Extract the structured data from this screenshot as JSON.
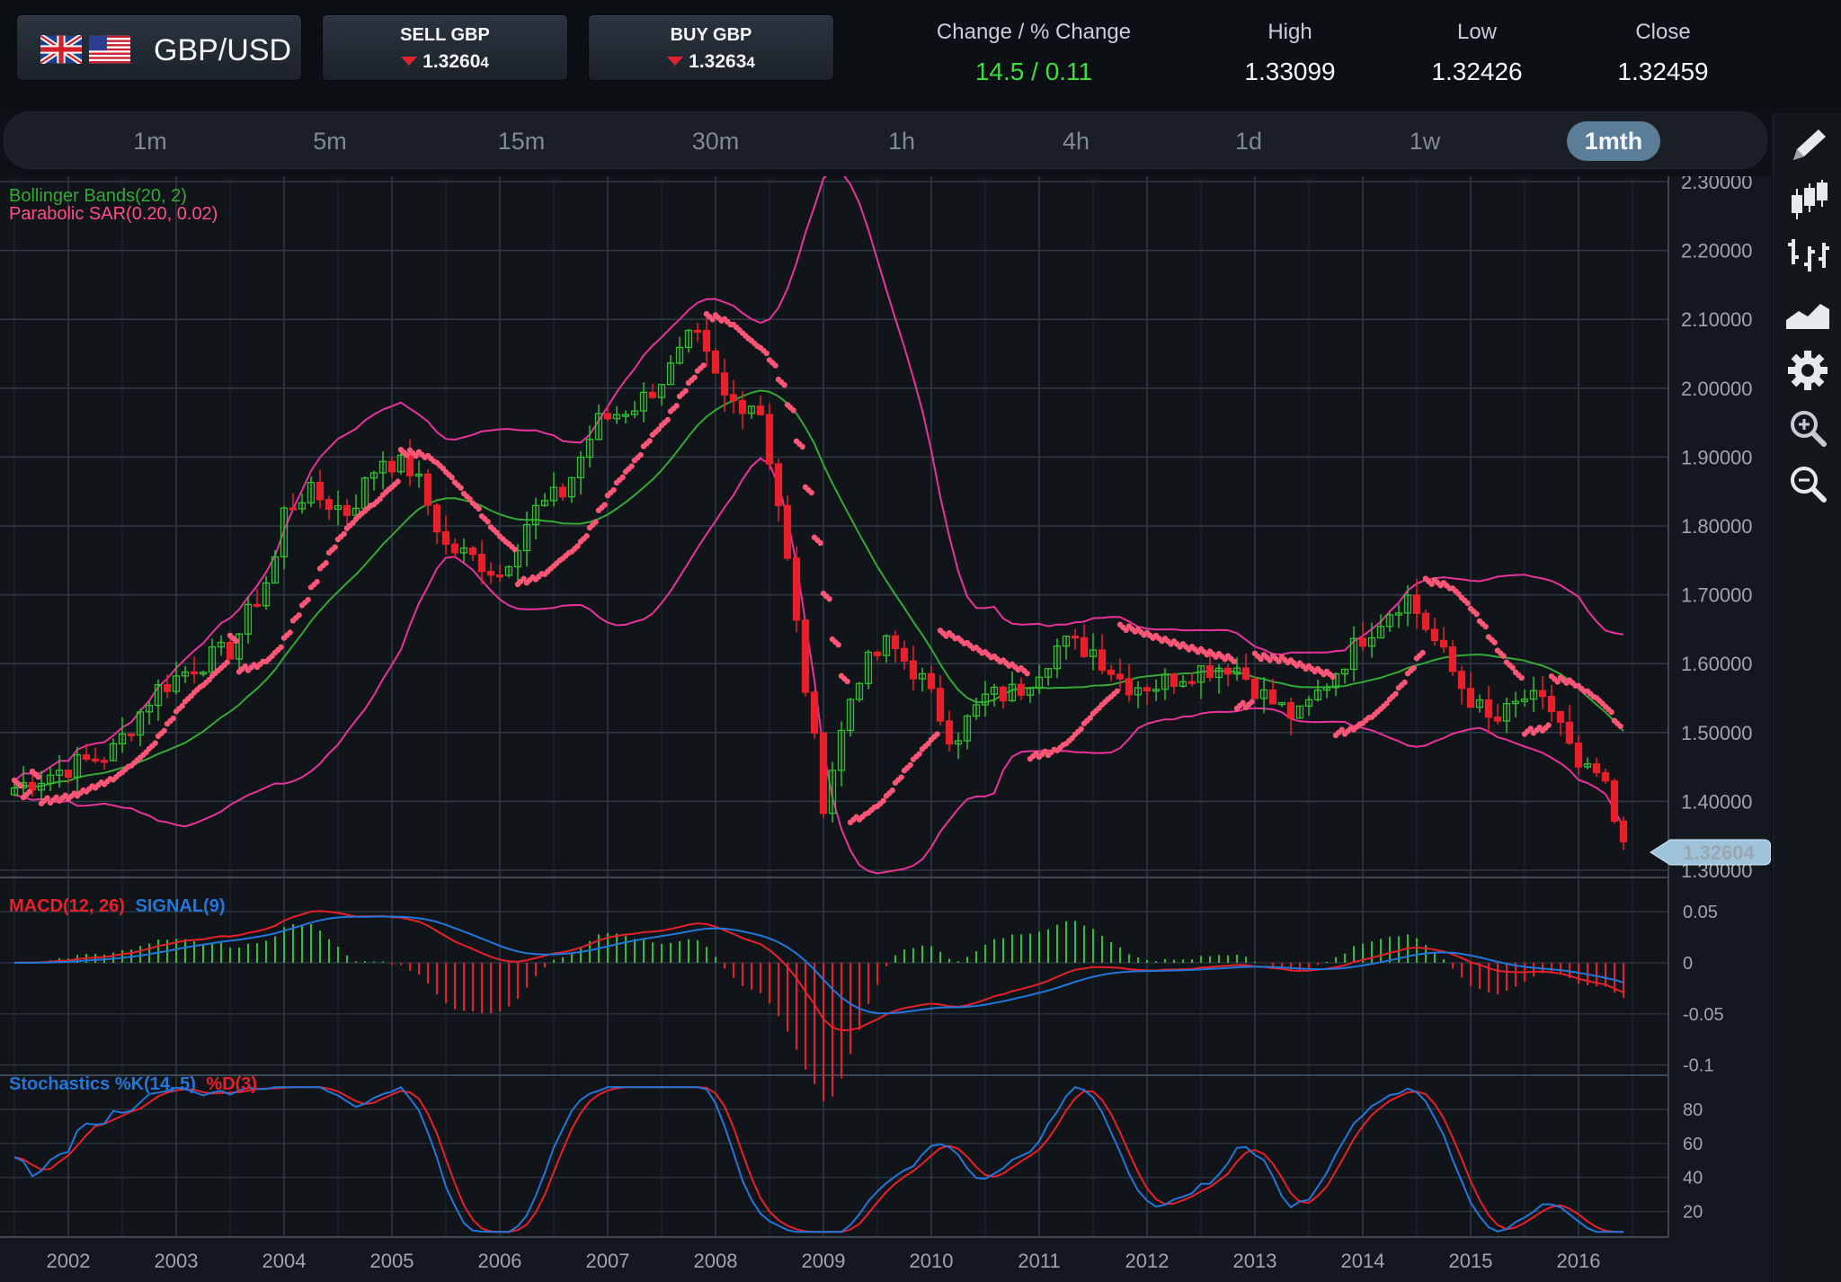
{
  "header": {
    "pair": "GBP/USD",
    "sell": {
      "label": "SELL GBP",
      "price_main": "1.3260",
      "price_pip": "4"
    },
    "buy": {
      "label": "BUY GBP",
      "price_main": "1.3263",
      "price_pip": "4"
    },
    "stats": [
      {
        "label": "Change / % Change",
        "value": "14.5 / 0.11"
      },
      {
        "label": "High",
        "value": "1.33099"
      },
      {
        "label": "Low",
        "value": "1.32426"
      },
      {
        "label": "Close",
        "value": "1.32459"
      }
    ]
  },
  "timeframes": [
    "1m",
    "5m",
    "15m",
    "30m",
    "1h",
    "4h",
    "1d",
    "1w",
    "1mth"
  ],
  "active_timeframe": "1mth",
  "tools": [
    "pencil-icon",
    "candlestick-icon",
    "ohlc-bars-icon",
    "area-chart-icon",
    "gear-icon",
    "zoom-in-icon",
    "zoom-out-icon"
  ],
  "colors": {
    "bull": "#2fbf2f",
    "bear": "#e8202c",
    "bollinger_outer": "#e8339c",
    "bollinger_mid": "#35a835",
    "sar": "#ff5577",
    "macd": "#e8202c",
    "signal": "#2277dd",
    "grid": "#2e3a47"
  },
  "chart_data": [
    {
      "type": "candlestick",
      "indicators": [
        "Bollinger Bands(20, 2)",
        "Parabolic SAR(0.20, 0.02)"
      ],
      "x_labels": [
        "2002",
        "2003",
        "2004",
        "2005",
        "2006",
        "2007",
        "2008",
        "2009",
        "2010",
        "2011",
        "2012",
        "2013",
        "2014",
        "2015",
        "2016"
      ],
      "y_ticks": [
        "2.30000",
        "2.20000",
        "2.10000",
        "2.00000",
        "1.90000",
        "1.80000",
        "1.70000",
        "1.60000",
        "1.50000",
        "1.40000",
        "1.30000"
      ],
      "ylim": [
        1.3,
        2.3
      ],
      "current_price_label": "1.32604",
      "current_price": 1.32604,
      "price_path_start_year": 2001.5,
      "price_path": [
        [
          2001.5,
          1.42
        ],
        [
          2002.0,
          1.45
        ],
        [
          2002.4,
          1.47
        ],
        [
          2002.8,
          1.56
        ],
        [
          2003.2,
          1.6
        ],
        [
          2003.5,
          1.62
        ],
        [
          2003.9,
          1.74
        ],
        [
          2004.0,
          1.82
        ],
        [
          2004.2,
          1.85
        ],
        [
          2004.6,
          1.82
        ],
        [
          2004.9,
          1.9
        ],
        [
          2005.2,
          1.88
        ],
        [
          2005.5,
          1.77
        ],
        [
          2005.8,
          1.75
        ],
        [
          2006.0,
          1.73
        ],
        [
          2006.3,
          1.82
        ],
        [
          2006.6,
          1.85
        ],
        [
          2006.9,
          1.95
        ],
        [
          2007.3,
          1.98
        ],
        [
          2007.6,
          2.03
        ],
        [
          2007.8,
          2.08
        ],
        [
          2008.1,
          1.98
        ],
        [
          2008.4,
          1.98
        ],
        [
          2008.6,
          1.82
        ],
        [
          2008.8,
          1.6
        ],
        [
          2009.0,
          1.4
        ],
        [
          2009.3,
          1.58
        ],
        [
          2009.6,
          1.63
        ],
        [
          2009.9,
          1.58
        ],
        [
          2010.2,
          1.49
        ],
        [
          2010.5,
          1.55
        ],
        [
          2010.8,
          1.56
        ],
        [
          2011.2,
          1.63
        ],
        [
          2011.5,
          1.62
        ],
        [
          2011.8,
          1.57
        ],
        [
          2012.1,
          1.57
        ],
        [
          2012.4,
          1.59
        ],
        [
          2012.8,
          1.6
        ],
        [
          2013.1,
          1.55
        ],
        [
          2013.4,
          1.52
        ],
        [
          2013.7,
          1.58
        ],
        [
          2014.0,
          1.64
        ],
        [
          2014.4,
          1.7
        ],
        [
          2014.6,
          1.65
        ],
        [
          2014.9,
          1.57
        ],
        [
          2015.2,
          1.51
        ],
        [
          2015.5,
          1.55
        ],
        [
          2015.8,
          1.53
        ],
        [
          2016.0,
          1.44
        ],
        [
          2016.2,
          1.44
        ],
        [
          2016.4,
          1.33
        ]
      ]
    },
    {
      "type": "line",
      "title": "MACD(12, 26) SIGNAL(9)",
      "series": [
        {
          "name": "MACD(12, 26)"
        },
        {
          "name": "SIGNAL(9)"
        }
      ],
      "y_ticks": [
        "0.05",
        "0",
        "-0.05",
        "-0.1"
      ],
      "ylim": [
        -0.11,
        0.08
      ]
    },
    {
      "type": "line",
      "title": "Stochastics %K(14, 5) %D(3)",
      "series": [
        {
          "name": "%K(14, 5)"
        },
        {
          "name": "%D(3)"
        }
      ],
      "y_ticks": [
        "80",
        "60",
        "40",
        "20"
      ],
      "ylim": [
        5,
        100
      ]
    }
  ]
}
